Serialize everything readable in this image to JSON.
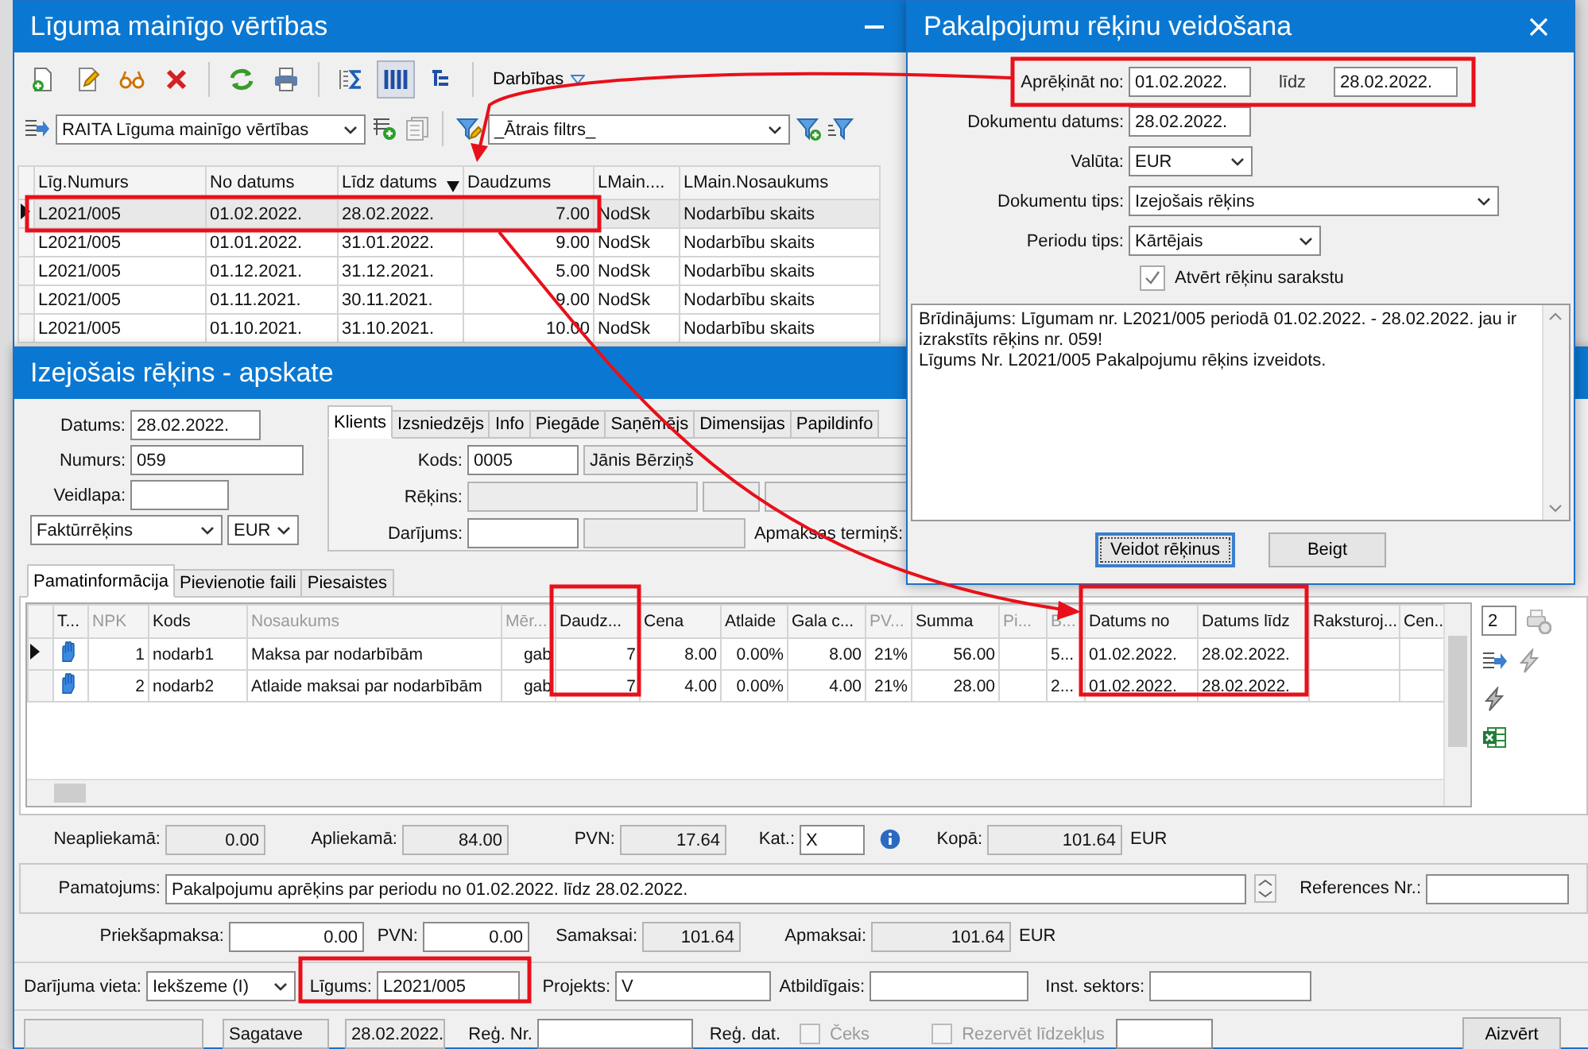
{
  "contract_window": {
    "title": "Līguma mainīgo vērtības",
    "actions_menu": "Darbības",
    "view_toggle_pressed": true,
    "view_select": "RAITA Līguma mainīgo vērtības",
    "filter_select": "_Ātrais filtrs_",
    "table": {
      "columns": [
        {
          "label": "Līg.Numurs",
          "sorted": false
        },
        {
          "label": "No datums",
          "sorted": false
        },
        {
          "label": "Līdz datums",
          "sorted": true
        },
        {
          "label": "Daudzums",
          "sorted": false
        },
        {
          "label": "LMain....",
          "sorted": false
        },
        {
          "label": "LMain.Nosaukums",
          "sorted": false
        }
      ],
      "rows": [
        {
          "selected": true,
          "cells": [
            "L2021/005",
            "01.02.2022.",
            "28.02.2022.",
            "7.00",
            "NodSk",
            "Nodarbību skaits"
          ]
        },
        {
          "selected": false,
          "cells": [
            "L2021/005",
            "01.01.2022.",
            "31.01.2022.",
            "9.00",
            "NodSk",
            "Nodarbību skaits"
          ]
        },
        {
          "selected": false,
          "cells": [
            "L2021/005",
            "01.12.2021.",
            "31.12.2021.",
            "5.00",
            "NodSk",
            "Nodarbību skaits"
          ]
        },
        {
          "selected": false,
          "cells": [
            "L2021/005",
            "01.11.2021.",
            "30.11.2021.",
            "9.00",
            "NodSk",
            "Nodarbību skaits"
          ]
        },
        {
          "selected": false,
          "cells": [
            "L2021/005",
            "01.10.2021.",
            "31.10.2021.",
            "10.00",
            "NodSk",
            "Nodarbību skaits"
          ]
        }
      ]
    }
  },
  "service_dialog": {
    "title": "Pakalpojumu rēķinu veidošana",
    "period": {
      "label": "Aprēķināt no:",
      "from": "01.02.2022.",
      "to_label": "līdz",
      "to": "28.02.2022."
    },
    "doc_date": {
      "label": "Dokumentu datums:",
      "value": "28.02.2022."
    },
    "currency": {
      "label": "Valūta:",
      "value": "EUR"
    },
    "doc_type": {
      "label": "Dokumentu tips:",
      "value": "Izejošais rēķins"
    },
    "period_type": {
      "label": "Periodu tips:",
      "value": "Kārtējais"
    },
    "open_list": {
      "label": "Atvērt rēķinu sarakstu",
      "checked": true
    },
    "log": [
      "Brīdinājums: Līgumam nr. L2021/005 periodā 01.02.2022. - 28.02.2022. jau ir izrakstīts rēķins nr. 059!",
      "Līgums Nr. L2021/005 Pakalpojumu rēķins izveidots."
    ],
    "buttons": [
      {
        "label": "Veidot rēķinus",
        "default": true
      },
      {
        "label": "Beigt",
        "default": false
      }
    ]
  },
  "invoice_window": {
    "title": "Izejošais rēķins - apskate",
    "date": {
      "label": "Datums:",
      "value": "28.02.2022."
    },
    "number": {
      "label": "Numurs:",
      "value": "059"
    },
    "form_label": "Veidlapa:",
    "doc_kind": "Faktūrrēķins",
    "currency": "EUR",
    "party_tabs": [
      {
        "label": "Klients",
        "selected": true
      },
      {
        "label": "Izsniedzējs",
        "selected": false
      },
      {
        "label": "Info",
        "selected": false
      },
      {
        "label": "Piegāde",
        "selected": false
      },
      {
        "label": "Saņēmējs",
        "selected": false
      },
      {
        "label": "Dimensijas",
        "selected": false
      },
      {
        "label": "Papildinfo",
        "selected": false
      }
    ],
    "client": {
      "code_label": "Kods:",
      "code": "0005",
      "name": "Jānis Bērziņš",
      "account_label": "Rēķins:",
      "deal_label": "Darījums:",
      "terms_label": "Apmaksas termiņš:"
    },
    "section_tabs": [
      {
        "label": "Pamatinformācija",
        "selected": true
      },
      {
        "label": "Pievienotie faili",
        "selected": false
      },
      {
        "label": "Piesaistes",
        "selected": false
      }
    ],
    "lines": {
      "columns": [
        {
          "label": "T...",
          "greyed": false
        },
        {
          "label": "NPK",
          "greyed": true
        },
        {
          "label": "Kods",
          "greyed": false
        },
        {
          "label": "Nosaukums",
          "greyed": true
        },
        {
          "label": "Mēr...",
          "greyed": true
        },
        {
          "label": "Daudz...",
          "greyed": false
        },
        {
          "label": "Cena",
          "greyed": false
        },
        {
          "label": "Atlaide",
          "greyed": false
        },
        {
          "label": "Gala c...",
          "greyed": false
        },
        {
          "label": "PV...",
          "greyed": true
        },
        {
          "label": "Summa",
          "greyed": false
        },
        {
          "label": "Pi...",
          "greyed": true
        },
        {
          "label": "B...",
          "greyed": true
        },
        {
          "label": "Datums no",
          "greyed": false
        },
        {
          "label": "Datums līdz",
          "greyed": false
        },
        {
          "label": "Raksturoj...",
          "greyed": false
        },
        {
          "label": "Cen...",
          "greyed": false
        }
      ],
      "rows": [
        {
          "current": true,
          "cells": [
            "",
            "1",
            "nodarb1",
            "Maksa par nodarbībām",
            "gab",
            "7",
            "8.00",
            "0.00%",
            "8.00",
            "21%",
            "56.00",
            "",
            "5...",
            "01.02.2022.",
            "28.02.2022.",
            "",
            ""
          ]
        },
        {
          "current": false,
          "cells": [
            "",
            "2",
            "nodarb2",
            "Atlaide maksai par nodarbībām",
            "gab",
            "7",
            "4.00",
            "0.00%",
            "4.00",
            "21%",
            "28.00",
            "",
            "2...",
            "01.02.2022.",
            "28.02.2022.",
            "",
            ""
          ]
        }
      ]
    },
    "side_counter": "2",
    "totals": {
      "untaxed": {
        "label": "Neapliekamā:",
        "value": "0.00"
      },
      "taxable": {
        "label": "Apliekamā:",
        "value": "84.00"
      },
      "vat": {
        "label": "PVN:",
        "value": "17.64"
      },
      "category": {
        "label": "Kat.:",
        "value": "X"
      },
      "total": {
        "label": "Kopā:",
        "value": "101.64",
        "unit": "EUR"
      }
    },
    "basis": {
      "label": "Pamatojums:",
      "value": "Pakalpojumu aprēķins par periodu no 01.02.2022. līdz 28.02.2022.",
      "references_label": "References Nr.:"
    },
    "payment": {
      "prepay": {
        "label": "Priekšapmaksa:",
        "value": "0.00"
      },
      "prepay_vat": {
        "label": "PVN:",
        "value": "0.00"
      },
      "to_pay": {
        "label": "Samaksai:",
        "value": "101.64"
      },
      "due": {
        "label": "Apmaksai:",
        "value": "101.64",
        "unit": "EUR"
      }
    },
    "deal": {
      "place": {
        "label": "Darījuma vieta:",
        "value": "Iekšzeme (I)"
      },
      "contract": {
        "label": "Līgums:",
        "value": "L2021/005"
      },
      "project": {
        "label": "Projekts:",
        "value": "V"
      },
      "responsible_label": "Atbildīgais:",
      "sector_label": "Inst. sektors:"
    },
    "status": {
      "state": "Sagatave",
      "date": "28.02.2022.",
      "reg_no_label": "Reģ. Nr.",
      "reg_date_label": "Reģ. dat.",
      "receipt": {
        "label": "Čeks",
        "checked": false,
        "disabled": true
      },
      "reserve": {
        "label": "Rezervēt līdzekļus",
        "checked": false,
        "disabled": true
      },
      "close_button": "Aizvērt"
    }
  }
}
